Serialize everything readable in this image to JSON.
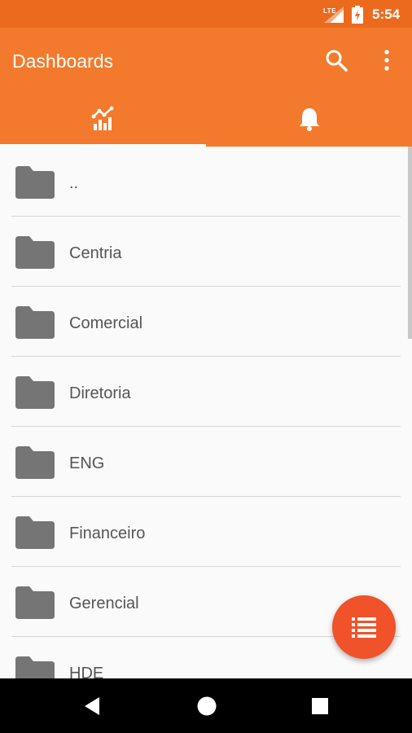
{
  "status_bar": {
    "network": "LTE",
    "time": "5:54",
    "signal_icon": "cell-signal-icon",
    "battery_icon": "battery-charging-icon"
  },
  "app_bar": {
    "title": "Dashboards",
    "search_icon": "search-icon",
    "more_icon": "more-vert-icon"
  },
  "tabs": [
    {
      "icon": "dashboard-chart-icon",
      "selected": true
    },
    {
      "icon": "bell-icon",
      "selected": false
    }
  ],
  "folders": [
    {
      "label": ".."
    },
    {
      "label": "Centria"
    },
    {
      "label": "Comercial"
    },
    {
      "label": "Diretoria"
    },
    {
      "label": "ENG"
    },
    {
      "label": "Financeiro"
    },
    {
      "label": "Gerencial"
    },
    {
      "label": "HDE"
    }
  ],
  "fab": {
    "icon": "list-icon"
  },
  "nav_bar": {
    "icons": [
      "back-icon",
      "home-icon",
      "recents-icon"
    ]
  },
  "colors": {
    "status_bar": "#ec6a1e",
    "app_bar": "#f37a2c",
    "fab": "#f0522a",
    "folder": "#757575",
    "text": "#555555"
  }
}
